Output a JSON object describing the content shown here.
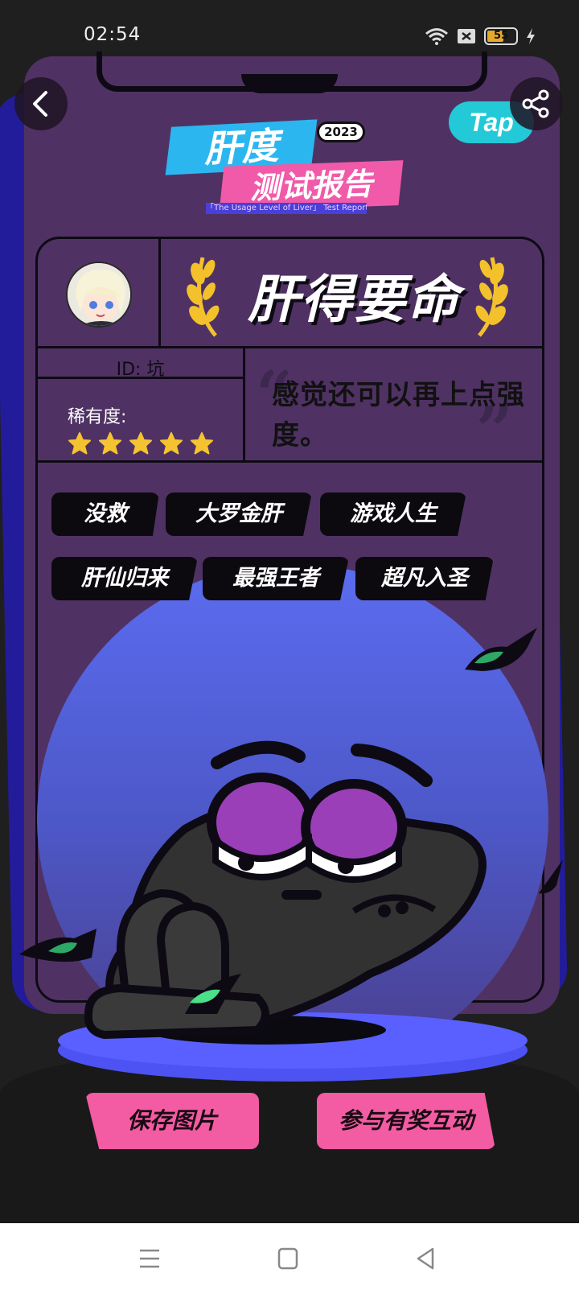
{
  "status_bar": {
    "time": "02:54",
    "battery_level": "55"
  },
  "header": {
    "brand_logo_text": "Tap",
    "title_line1": "肝度",
    "title_year": "2023",
    "title_line2": "测试报告",
    "subtitle": "「The Usage Level of Liver」 Test Report"
  },
  "report": {
    "level_title": "肝得要命",
    "user_id": "ID: 坑",
    "rarity_label": "稀有度:",
    "rarity_stars": 5,
    "comment": "感觉还可以再上点强度。",
    "tags": [
      "没救",
      "大罗金肝",
      "游戏人生",
      "肝仙归来",
      "最强王者",
      "超凡入圣"
    ]
  },
  "actions": {
    "save_label": "保存图片",
    "join_label": "参与有奖互动"
  },
  "colors": {
    "card": "#4f3263",
    "accent_pink": "#f35ba2",
    "accent_blue": "#2cb6f0",
    "star": "#f6c330",
    "planet": "#5b6cf0"
  }
}
